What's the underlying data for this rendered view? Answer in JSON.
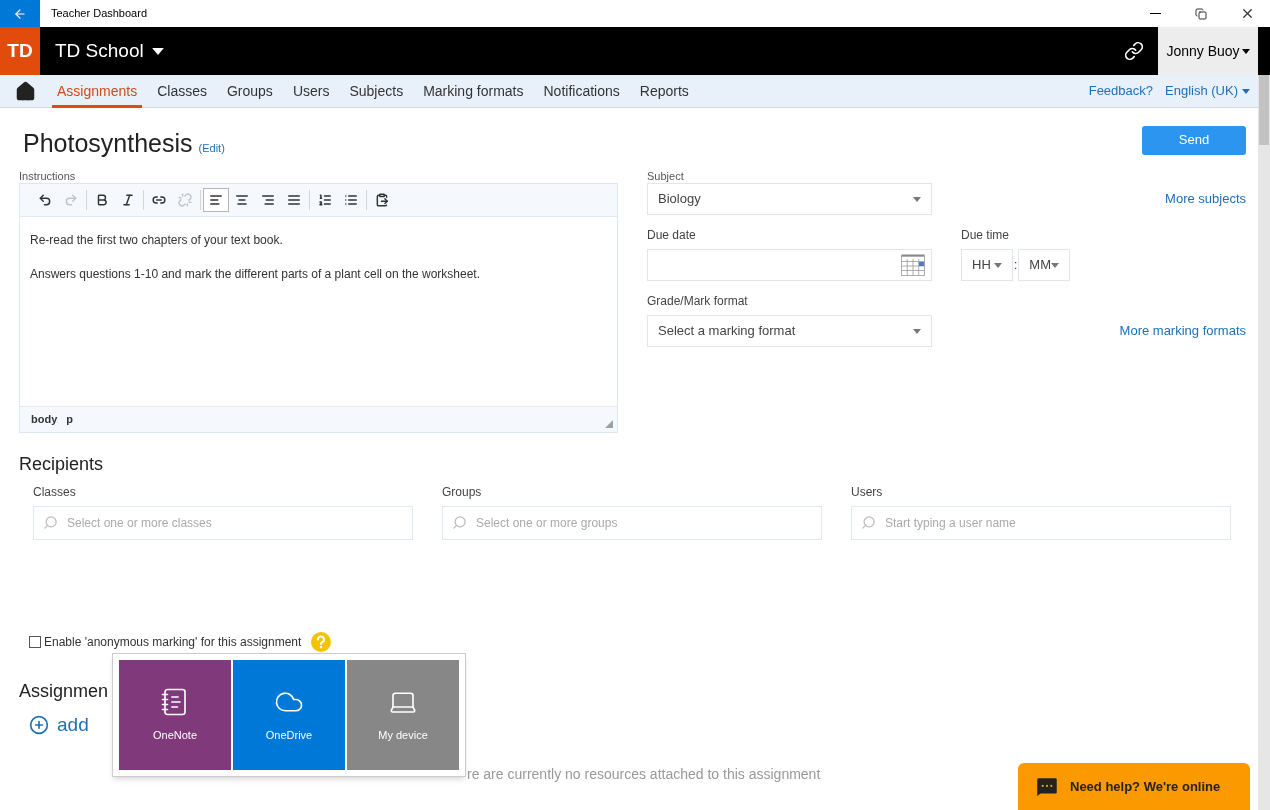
{
  "window": {
    "title": "Teacher Dashboard"
  },
  "header": {
    "logo": "TD",
    "school": "TD School",
    "user": "Jonny Buoy"
  },
  "nav": {
    "tabs": [
      {
        "label": "Assignments",
        "selected": true
      },
      {
        "label": "Classes",
        "selected": false
      },
      {
        "label": "Groups",
        "selected": false
      },
      {
        "label": "Users",
        "selected": false
      },
      {
        "label": "Subjects",
        "selected": false
      },
      {
        "label": "Marking formats",
        "selected": false
      },
      {
        "label": "Notifications",
        "selected": false
      },
      {
        "label": "Reports",
        "selected": false
      }
    ],
    "feedback": "Feedback?",
    "language": "English (UK)"
  },
  "assignment": {
    "title": "Photosynthesis",
    "edit": "(Edit)",
    "send": "Send"
  },
  "instructions": {
    "label": "Instructions",
    "toolbar": [
      {
        "kind": "undo",
        "disabled": false,
        "selected": false
      },
      {
        "kind": "redo",
        "disabled": true,
        "selected": false
      },
      {
        "kind": "bold",
        "disabled": false,
        "selected": false
      },
      {
        "kind": "italic",
        "disabled": false,
        "selected": false
      },
      {
        "kind": "link",
        "disabled": false,
        "selected": false
      },
      {
        "kind": "unlink",
        "disabled": true,
        "selected": false
      },
      {
        "kind": "align-left",
        "disabled": false,
        "selected": true
      },
      {
        "kind": "align-center",
        "disabled": false,
        "selected": false
      },
      {
        "kind": "align-right",
        "disabled": false,
        "selected": false
      },
      {
        "kind": "align-justify",
        "disabled": false,
        "selected": false
      },
      {
        "kind": "numbered-list",
        "disabled": false,
        "selected": false
      },
      {
        "kind": "bullet-list",
        "disabled": false,
        "selected": false
      },
      {
        "kind": "paste",
        "disabled": false,
        "selected": false
      }
    ],
    "paragraphs": [
      "Re-read the first two chapters of your text book.",
      "Answers questions 1-10 and mark the different parts of a plant cell on the worksheet."
    ],
    "path": [
      "body",
      "p"
    ]
  },
  "subject": {
    "label": "Subject",
    "value": "Biology",
    "more": "More subjects"
  },
  "due_date": {
    "label": "Due date"
  },
  "due_time": {
    "label": "Due time",
    "hour": "HH",
    "separator": ":",
    "minute": "MM"
  },
  "mark_format": {
    "label": "Grade/Mark format",
    "placeholder": "Select a marking format",
    "more": "More marking formats"
  },
  "recipients": {
    "title": "Recipients",
    "fields": [
      {
        "label": "Classes",
        "placeholder": "Select one or more classes"
      },
      {
        "label": "Groups",
        "placeholder": "Select one or more groups"
      },
      {
        "label": "Users",
        "placeholder": "Start typing a user name"
      }
    ]
  },
  "anonymous": {
    "label": "Enable 'anonymous marking' for this assignment",
    "checked": false
  },
  "resources": {
    "title": "Assignmen",
    "add": "add",
    "empty": "re are currently no resources attached to this assignment"
  },
  "popup": {
    "tiles": [
      {
        "kind": "onenote",
        "label": "OneNote",
        "color": "#80397b"
      },
      {
        "kind": "onedrive",
        "label": "OneDrive",
        "color": "#0078d7"
      },
      {
        "kind": "device",
        "label": "My device",
        "color": "#878787"
      }
    ]
  },
  "help": {
    "label": "Need help? We're online"
  }
}
